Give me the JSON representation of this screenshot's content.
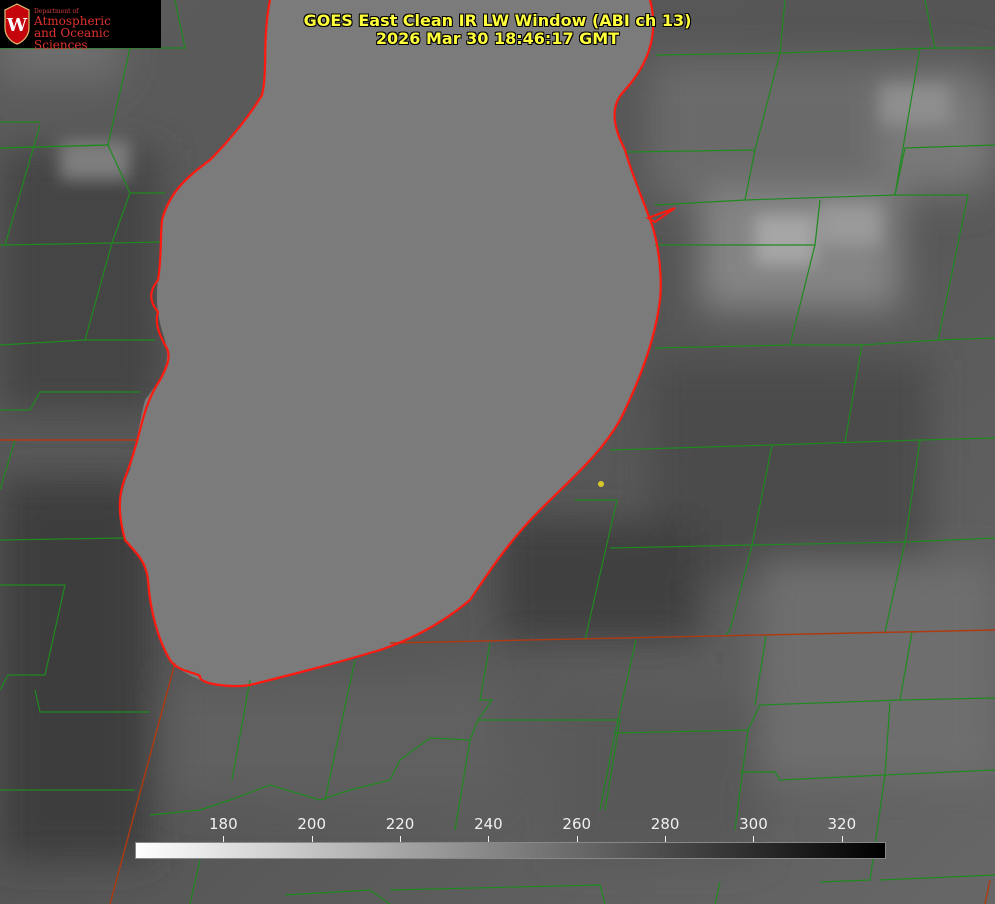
{
  "product": {
    "title_line1": "GOES East Clean IR LW Window (ABI ch 13)",
    "title_line2": "2026 Mar 30 18:46:17 GMT",
    "title_color": "#ffff3c"
  },
  "logo": {
    "department": "Department of",
    "line1": "Atmospheric",
    "line2": "and Oceanic Sciences",
    "crest_letter": "W",
    "accent_color": "#c5050c"
  },
  "colorbar": {
    "tick_labels": [
      "180",
      "200",
      "220",
      "240",
      "260",
      "280",
      "300",
      "320"
    ],
    "min": 160,
    "max": 330,
    "start_color": "#ffffff",
    "end_color": "#000000"
  },
  "map": {
    "lake_color": "#7b7b7b",
    "shoreline_color": "#ff1a10",
    "county_color": "#1f8a1f",
    "state_color": "#b03a10",
    "marker_color": "#d8c82a"
  }
}
